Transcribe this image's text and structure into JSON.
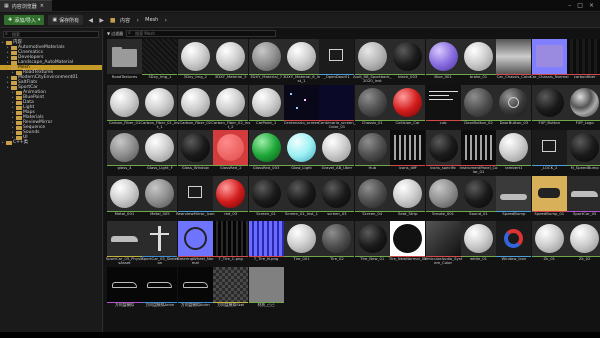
{
  "window": {
    "tab_label": "内容浏览器",
    "icon": "content-browser-icon"
  },
  "toolbar": {
    "add_import": "添加/导入",
    "save_all": "保存所有",
    "breadcrumb": [
      "内容",
      "Mesh"
    ]
  },
  "left": {
    "search_placeholder": "搜索",
    "tree": [
      {
        "label": "内容",
        "depth": 0
      },
      {
        "label": "AutomotiveMaterials",
        "depth": 1
      },
      {
        "label": "Cinematics",
        "depth": 1
      },
      {
        "label": "Developers",
        "depth": 1
      },
      {
        "label": "Landscape_AutoMaterial",
        "depth": 1
      },
      {
        "label": "Mesh",
        "depth": 1,
        "selected": true
      },
      {
        "label": "RoadTextures",
        "depth": 2
      },
      {
        "label": "ModernCityEnvironment01",
        "depth": 1
      },
      {
        "label": "SaltFlats",
        "depth": 1
      },
      {
        "label": "SportCar",
        "depth": 1
      },
      {
        "label": "Animation",
        "depth": 2
      },
      {
        "label": "BluePoint",
        "depth": 2
      },
      {
        "label": "Data",
        "depth": 2
      },
      {
        "label": "Light",
        "depth": 2
      },
      {
        "label": "Maps",
        "depth": 2
      },
      {
        "label": "Materials",
        "depth": 2
      },
      {
        "label": "ReviewMirror",
        "depth": 2
      },
      {
        "label": "Sequence",
        "depth": 2
      },
      {
        "label": "Sounds",
        "depth": 2
      },
      {
        "label": "UI",
        "depth": 2
      },
      {
        "label": "C++类",
        "depth": 0
      }
    ]
  },
  "main": {
    "filter_label": "过滤器",
    "search_placeholder": "搜索 Mesh",
    "assets": [
      {
        "label": "RoadTextures",
        "kind": "folder",
        "bar": ""
      },
      {
        "label": "3Dxy_Img_1",
        "kind": "dark",
        "bar": "#6ea84a"
      },
      {
        "label": "3Dxy_Img_2",
        "kind": "white",
        "bar": "#6ea84a"
      },
      {
        "label": "3DXY_Material_5",
        "kind": "white",
        "bar": "#6ea84a"
      },
      {
        "label": "3DXY_Material_7",
        "kind": "grey",
        "bar": "#6ea84a"
      },
      {
        "label": "3DXY_Material_6_Inst_1",
        "kind": "white",
        "bar": "#6ea84a"
      },
      {
        "label": "_OpenDoor01",
        "kind": "bp",
        "bar": "#4aa0d8"
      },
      {
        "label": "Audi_R8_Sportback_2020_Inst",
        "kind": "lightgrey",
        "bar": "#6ea84a"
      },
      {
        "label": "black_003",
        "kind": "black",
        "bar": "#6ea84a"
      },
      {
        "label": "Blue_001",
        "kind": "purple",
        "bar": "#6ea84a"
      },
      {
        "label": "brake_01",
        "kind": "white",
        "bar": "#6ea84a"
      },
      {
        "label": "Car_Chassis_Color",
        "kind": "chassis",
        "bar": "#d34848"
      },
      {
        "label": "Car_Chassis_Normal",
        "kind": "normal",
        "bar": "#d34848"
      },
      {
        "label": "carbonfiber",
        "kind": "darkweave",
        "bar": "#d34848"
      },
      {
        "label": "Carbon_Fiber_01",
        "kind": "white",
        "bar": "#6ea84a"
      },
      {
        "label": "Carbon_Fiber_01_Inst_1",
        "kind": "white",
        "bar": "#6ea84a"
      },
      {
        "label": "Carbon_Fiber_02",
        "kind": "white",
        "bar": "#6ea84a"
      },
      {
        "label": "Carbon_Fiber_02_Inst_2",
        "kind": "white",
        "bar": "#6ea84a"
      },
      {
        "label": "CarPoint_1",
        "kind": "white",
        "bar": "#6ea84a"
      },
      {
        "label": "Centenario_screen",
        "kind": "darkspots",
        "bar": "#d34848"
      },
      {
        "label": "Centenario_screen_Color_01",
        "kind": "navy",
        "bar": "#d34848"
      },
      {
        "label": "Chassis_01",
        "kind": "darkgrey",
        "bar": "#6ea84a"
      },
      {
        "label": "Collision_Car",
        "kind": "red",
        "bar": "#6ea84a"
      },
      {
        "label": "cub",
        "kind": "text",
        "bar": "#d34848"
      },
      {
        "label": "DoorButton_02",
        "kind": "darkgrey",
        "bar": "#6ea84a"
      },
      {
        "label": "DoorButton_03",
        "kind": "darkbtn",
        "bar": "#6ea84a"
      },
      {
        "label": "FXP_Button",
        "kind": "black",
        "bar": "#6ea84a"
      },
      {
        "label": "FXP_Logo",
        "kind": "chrome",
        "bar": "#6ea84a"
      },
      {
        "label": "glass_4",
        "kind": "grey",
        "bar": "#6ea84a"
      },
      {
        "label": "Glass_Light_F",
        "kind": "white",
        "bar": "#6ea84a"
      },
      {
        "label": "Glass_Window",
        "kind": "black",
        "bar": "#6ea84a"
      },
      {
        "label": "GlassRed_2",
        "kind": "redfield",
        "bar": "#6ea84a"
      },
      {
        "label": "GlassRed_003",
        "kind": "green",
        "bar": "#6ea84a"
      },
      {
        "label": "Glow_Light",
        "kind": "cyan",
        "bar": "#6ea84a"
      },
      {
        "label": "Gravel_AB_Uber",
        "kind": "white",
        "bar": "#6ea84a"
      },
      {
        "label": "Hub",
        "kind": "darkgrey",
        "bar": "#6ea84a"
      },
      {
        "label": "icons_diff",
        "kind": "icons",
        "bar": "#d34848"
      },
      {
        "label": "icons_specific",
        "kind": "black",
        "bar": "#d34848"
      },
      {
        "label": "InstrumentPanel_Color_01",
        "kind": "icons",
        "bar": "#d34848"
      },
      {
        "label": "lambert1",
        "kind": "white",
        "bar": "#6ea84a"
      },
      {
        "label": "_LOCK_2",
        "kind": "bp",
        "bar": "#4aa0d8"
      },
      {
        "label": "M_SpeedBump",
        "kind": "black",
        "bar": "#6ea84a"
      },
      {
        "label": "Metal_001",
        "kind": "white",
        "bar": "#6ea84a"
      },
      {
        "label": "Metal_005",
        "kind": "grey",
        "bar": "#6ea84a"
      },
      {
        "label": "RearviewMirror_Icon",
        "kind": "bp",
        "bar": "#4aa0d8"
      },
      {
        "label": "red_03",
        "kind": "red",
        "bar": "#6ea84a"
      },
      {
        "label": "Screen_01",
        "kind": "black",
        "bar": "#6ea84a"
      },
      {
        "label": "Screen_01_Inst_1",
        "kind": "black",
        "bar": "#6ea84a"
      },
      {
        "label": "screen_03",
        "kind": "black",
        "bar": "#6ea84a"
      },
      {
        "label": "Screen_04",
        "kind": "darkgrey",
        "bar": "#6ea84a"
      },
      {
        "label": "Seat_Strip",
        "kind": "white",
        "bar": "#6ea84a"
      },
      {
        "label": "Smoke_001",
        "kind": "grey",
        "bar": "#6ea84a"
      },
      {
        "label": "Sound_01",
        "kind": "black",
        "bar": "#6ea84a"
      },
      {
        "label": "SpeedBump",
        "kind": "mesh",
        "bar": "#4aa0d8"
      },
      {
        "label": "SpeedBump_01",
        "kind": "cartex",
        "bar": "#d34848"
      },
      {
        "label": "SportCar_05",
        "kind": "car",
        "bar": "#b453d1"
      },
      {
        "label": "SportCar_05_PhysicsAsset",
        "kind": "car",
        "bar": "#c2b33b"
      },
      {
        "label": "SportCar_05_Skeleton",
        "kind": "skel",
        "bar": "#3a8fd6"
      },
      {
        "label": "SteeringWheel_Normal",
        "kind": "steer",
        "bar": "#d34848"
      },
      {
        "label": "T_Tire_C.png",
        "kind": "tire",
        "bar": "#d34848"
      },
      {
        "label": "T_Tire_N.png",
        "kind": "tiren",
        "bar": "#d34848"
      },
      {
        "label": "Tire_001",
        "kind": "white",
        "bar": "#6ea84a"
      },
      {
        "label": "Tire_02",
        "kind": "darkgrey",
        "bar": "#6ea84a"
      },
      {
        "label": "Tire_New_01",
        "kind": "black",
        "bar": "#6ea84a"
      },
      {
        "label": "Tire_NewNormal_01",
        "kind": "radial",
        "bar": "#d34848"
      },
      {
        "label": "VehicularAudio_System_Color",
        "kind": "gradient",
        "bar": "#d34848"
      },
      {
        "label": "white_01",
        "kind": "white",
        "bar": "#6ea84a"
      },
      {
        "label": "Window_Icon",
        "kind": "window",
        "bar": "#4aa0d8"
      },
      {
        "label": "Zk_01",
        "kind": "white",
        "bar": "#6ea84a"
      },
      {
        "label": "Zk_02",
        "kind": "white",
        "bar": "#6ea84a"
      },
      {
        "label": "方向盘模拟",
        "kind": "carblack",
        "bar": "#b453d1"
      },
      {
        "label": "方向盘模拟Anim",
        "kind": "carblack",
        "bar": "#3a8fd6"
      },
      {
        "label": "方向盘模拟Anim",
        "kind": "carblack",
        "bar": "#3a8fd6"
      },
      {
        "label": "方向盘模拟Skel",
        "kind": "check",
        "bar": "#c2b33b"
      },
      {
        "label": "材质_己己",
        "kind": "graysq",
        "bar": "#6ea84a"
      }
    ]
  }
}
